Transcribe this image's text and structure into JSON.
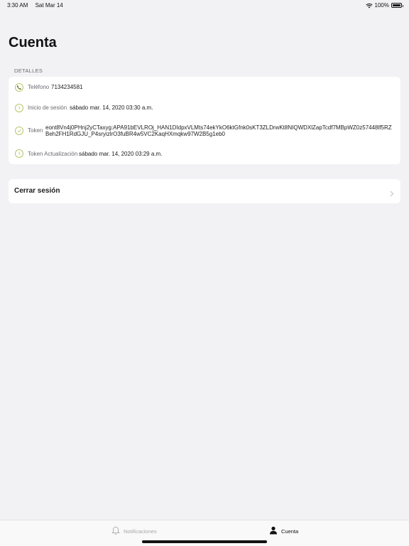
{
  "status_bar": {
    "time": "3:30 AM",
    "date": "Sat Mar 14",
    "battery": "100%",
    "battery_level": 1.0,
    "icons": [
      "wifi-icon",
      "battery-icon"
    ]
  },
  "page": {
    "title": "Cuenta",
    "section_header": "DETALLES"
  },
  "details": {
    "icon_color": "#b9c66a",
    "rows": [
      {
        "label": "Teléfono",
        "value": "7134234581",
        "icon": "phone-icon"
      },
      {
        "label": "Inicio de sesión",
        "value": "sábado mar. 14, 2020 03:30 a.m.",
        "icon": "clock-icon"
      },
      {
        "label": "Token",
        "value": "eont8Vn4j0PHnj2yCTaxyg:APA91bEVLROj_HAN1DIdpxVLMts74ekYkO6ktGfnk0sKT3ZLDrwKt8NIQWDXlZapTcdf7MBpWZ0z57448lf5RZBeh2FH1RdGJU_P4sryizlrO3fuBR4w5VC2KaqHXmqkw97W2B5g1eb0",
        "icon": "check-circle-icon"
      },
      {
        "label": "Token Actualización",
        "value": "sábado mar. 14, 2020 03:29 a.m.",
        "icon": "clock-icon"
      }
    ]
  },
  "logout": {
    "label": "Cerrar sesión",
    "icon": "chevron-right-icon"
  },
  "tab_bar": {
    "tabs": [
      {
        "label": "Notificaciones",
        "icon": "bell-icon",
        "selected": false
      },
      {
        "label": "Cuenta",
        "icon": "person-icon",
        "selected": true
      }
    ]
  }
}
